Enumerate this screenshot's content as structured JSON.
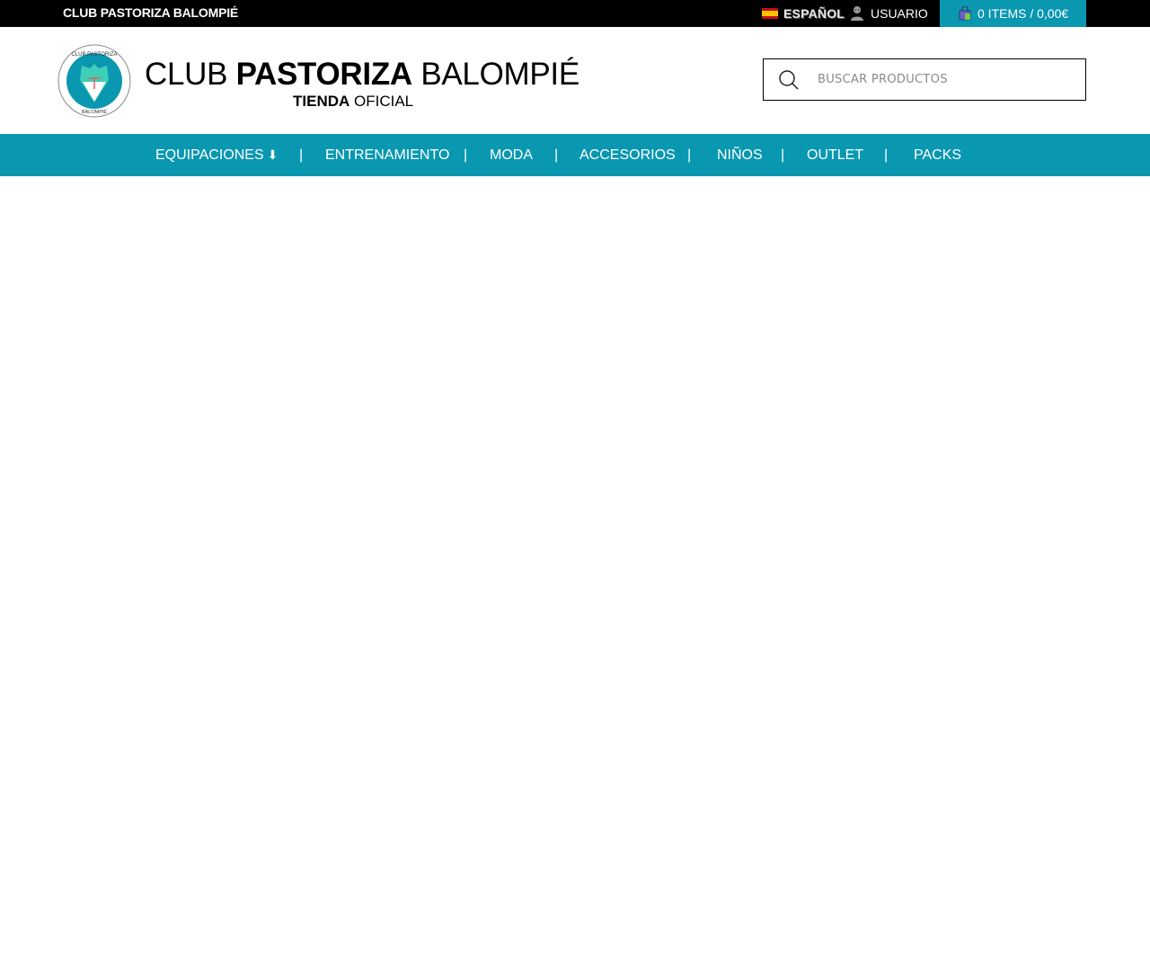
{
  "topbar": {
    "brand": "CLUB PASTORIZA BALOMPIÉ",
    "language": "ESPAÑOL",
    "user_label": "USUARIO",
    "cart_label": "0 ITEMS / 0,00€"
  },
  "header": {
    "title_part1": "CLUB ",
    "title_bold": "PASTORIZA",
    "title_part2": " BALOMPIÉ",
    "subtitle_bold": "TIENDA",
    "subtitle_rest": " OFICIAL",
    "logo_top_text": "CLUB PASTORIZA",
    "logo_bottom_text": "BALOMPIÉ"
  },
  "search": {
    "placeholder": "BUSCAR PRODUCTOS"
  },
  "nav": {
    "items": [
      {
        "label": "EQUIPACIONES",
        "icon": "arrow-down-icon"
      },
      {
        "label": "ENTRENAMIENTO"
      },
      {
        "label": "MODA"
      },
      {
        "label": "ACCESORIOS"
      },
      {
        "label": "NIÑOS"
      },
      {
        "label": "OUTLET"
      },
      {
        "label": "PACKS"
      }
    ],
    "separator": "|",
    "arrow_glyph": "⬇"
  },
  "colors": {
    "topbar_bg": "#000000",
    "accent": "#0a97b0",
    "text": "#000000"
  }
}
